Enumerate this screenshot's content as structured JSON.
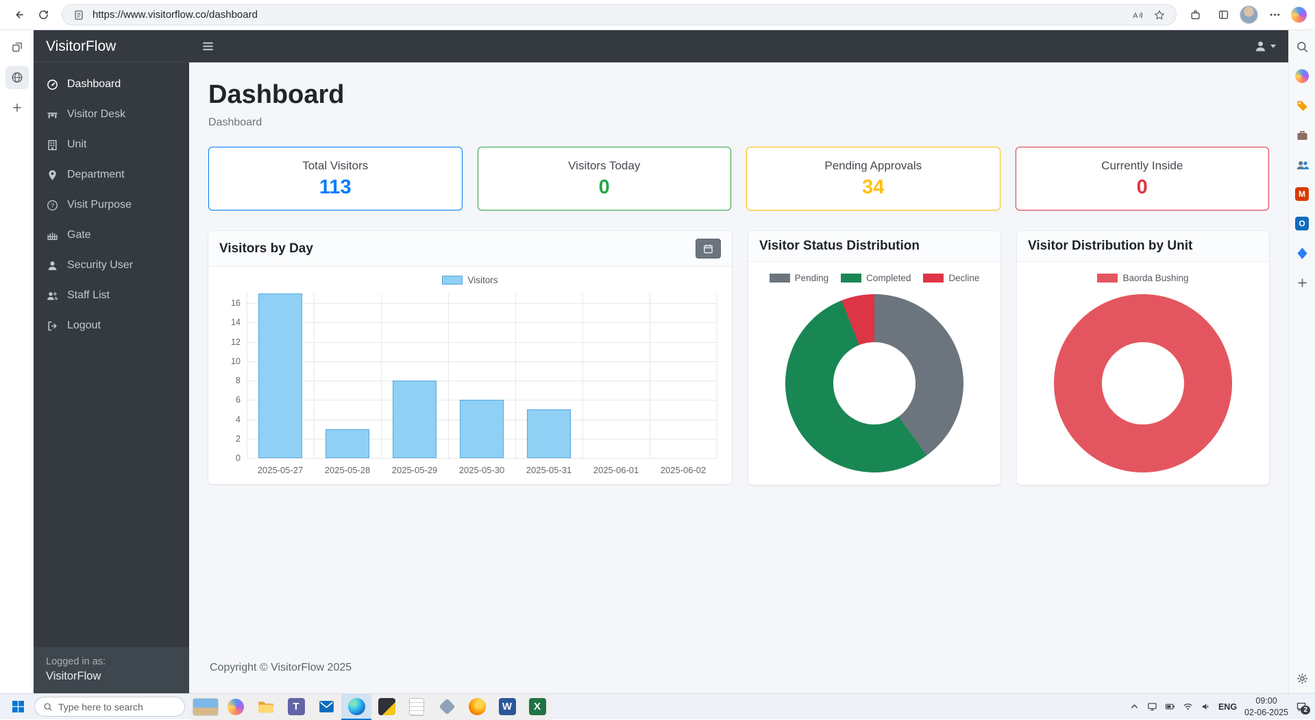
{
  "browser": {
    "url": "https://www.visitorflow.co/dashboard"
  },
  "edge_sidebar": {
    "top_icons": [
      "search",
      "copilot",
      "tags",
      "briefcase",
      "people",
      "microsoft-365",
      "outlook",
      "drop",
      "add"
    ],
    "bottom_icon": "settings"
  },
  "app": {
    "brand": "VisitorFlow",
    "sidebar": {
      "items": [
        {
          "label": "Dashboard",
          "icon": "speedometer",
          "active": true
        },
        {
          "label": "Visitor Desk",
          "icon": "desk",
          "active": false
        },
        {
          "label": "Unit",
          "icon": "building",
          "active": false
        },
        {
          "label": "Department",
          "icon": "marker",
          "active": false
        },
        {
          "label": "Visit Purpose",
          "icon": "question",
          "active": false
        },
        {
          "label": "Gate",
          "icon": "gate",
          "active": false
        },
        {
          "label": "Security User",
          "icon": "user",
          "active": false
        },
        {
          "label": "Staff List",
          "icon": "users",
          "active": false
        },
        {
          "label": "Logout",
          "icon": "logout",
          "active": false
        }
      ],
      "logged_in_label": "Logged in as:",
      "logged_in_user": "VisitorFlow"
    },
    "page_title": "Dashboard",
    "breadcrumb": "Dashboard",
    "stats": [
      {
        "label": "Total Visitors",
        "value": "113",
        "color": "#007bff"
      },
      {
        "label": "Visitors Today",
        "value": "0",
        "color": "#28a745"
      },
      {
        "label": "Pending Approvals",
        "value": "34",
        "color": "#ffc107"
      },
      {
        "label": "Currently Inside",
        "value": "0",
        "color": "#dc3545"
      }
    ],
    "footer": "Copyright © VisitorFlow 2025"
  },
  "chart_data": [
    {
      "type": "bar",
      "title": "Visitors by Day",
      "legend": [
        "Visitors"
      ],
      "categories": [
        "2025-05-27",
        "2025-05-28",
        "2025-05-29",
        "2025-05-30",
        "2025-05-31",
        "2025-06-01",
        "2025-06-02"
      ],
      "values": [
        17,
        3,
        8,
        6,
        5,
        0,
        0
      ],
      "xlabel": "",
      "ylabel": "",
      "ylim": [
        0,
        17
      ],
      "yticks": [
        0,
        2,
        4,
        6,
        8,
        10,
        12,
        14,
        16
      ],
      "grid": true,
      "legend_position": "top",
      "colors": {
        "fill": "#8fd0f4",
        "border": "#54a8dc"
      }
    },
    {
      "type": "pie",
      "title": "Visitor Status Distribution",
      "labels": [
        "Pending",
        "Completed",
        "Decline"
      ],
      "values": [
        40,
        54,
        6
      ],
      "units": "percent (estimated from donut angles)",
      "colors": [
        "#6c757d",
        "#198754",
        "#dc3545"
      ],
      "donut": true,
      "legend_position": "top"
    },
    {
      "type": "pie",
      "title": "Visitor Distribution by Unit",
      "labels": [
        "Baorda Bushing"
      ],
      "values": [
        100
      ],
      "units": "percent",
      "colors": [
        "#e4565f"
      ],
      "donut": true,
      "legend_position": "top"
    }
  ],
  "taskbar": {
    "search_placeholder": "Type here to search",
    "apps": [
      "news-widget",
      "copilot",
      "file-explorer",
      "teams",
      "mail",
      "edge",
      "notes",
      "notepad",
      "photos",
      "firefox",
      "word",
      "excel"
    ],
    "tray": {
      "lang": "ENG",
      "time": "09:00",
      "date": "02-06-2025",
      "badge": "2"
    }
  }
}
